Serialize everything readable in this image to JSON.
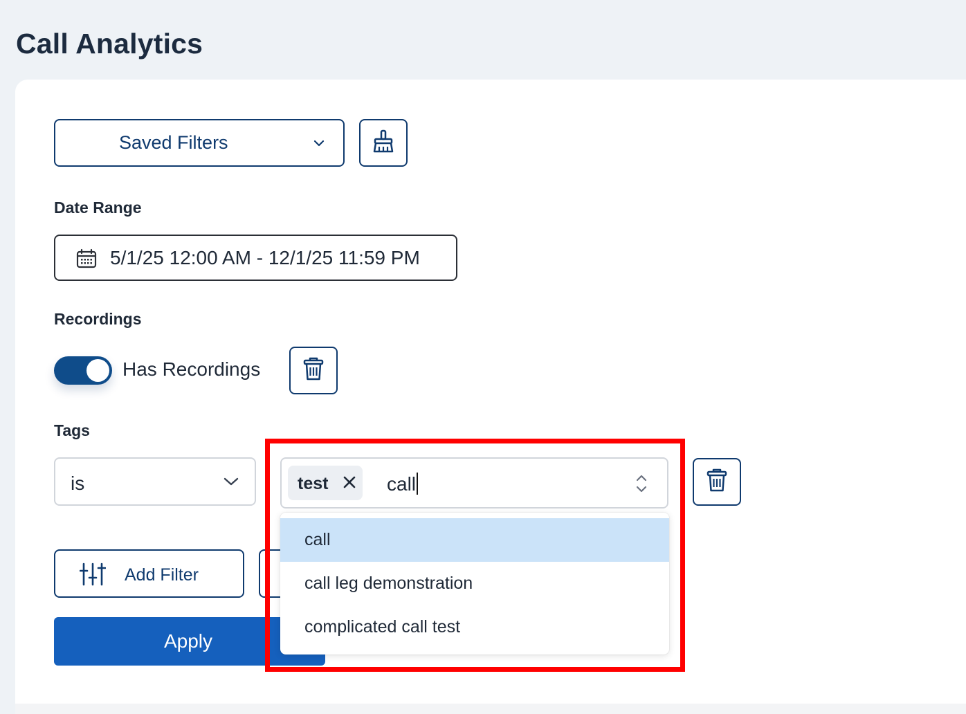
{
  "page": {
    "title": "Call Analytics"
  },
  "filters": {
    "saved_filters_label": "Saved Filters",
    "clear_icon": "broom-icon",
    "date_range": {
      "label": "Date Range",
      "value": "5/1/25 12:00 AM - 12/1/25 11:59 PM",
      "icon": "calendar-icon"
    },
    "recordings": {
      "label": "Recordings",
      "toggle_on": true,
      "toggle_label": "Has Recordings",
      "delete_icon": "trash-icon"
    },
    "tags": {
      "label": "Tags",
      "operator": "is",
      "selected_chips": [
        "test"
      ],
      "search_text": "call",
      "options": [
        "call",
        "call leg demonstration",
        "complicated call test"
      ],
      "highlighted_option_index": 0,
      "delete_icon": "trash-icon"
    },
    "add_filter_label": "Add Filter",
    "apply_label": "Apply"
  },
  "colors": {
    "brand_navy": "#0f3a6e",
    "apply_blue": "#1560bd",
    "option_highlight": "#cbe3f9",
    "annotation_red": "#ff0000"
  }
}
